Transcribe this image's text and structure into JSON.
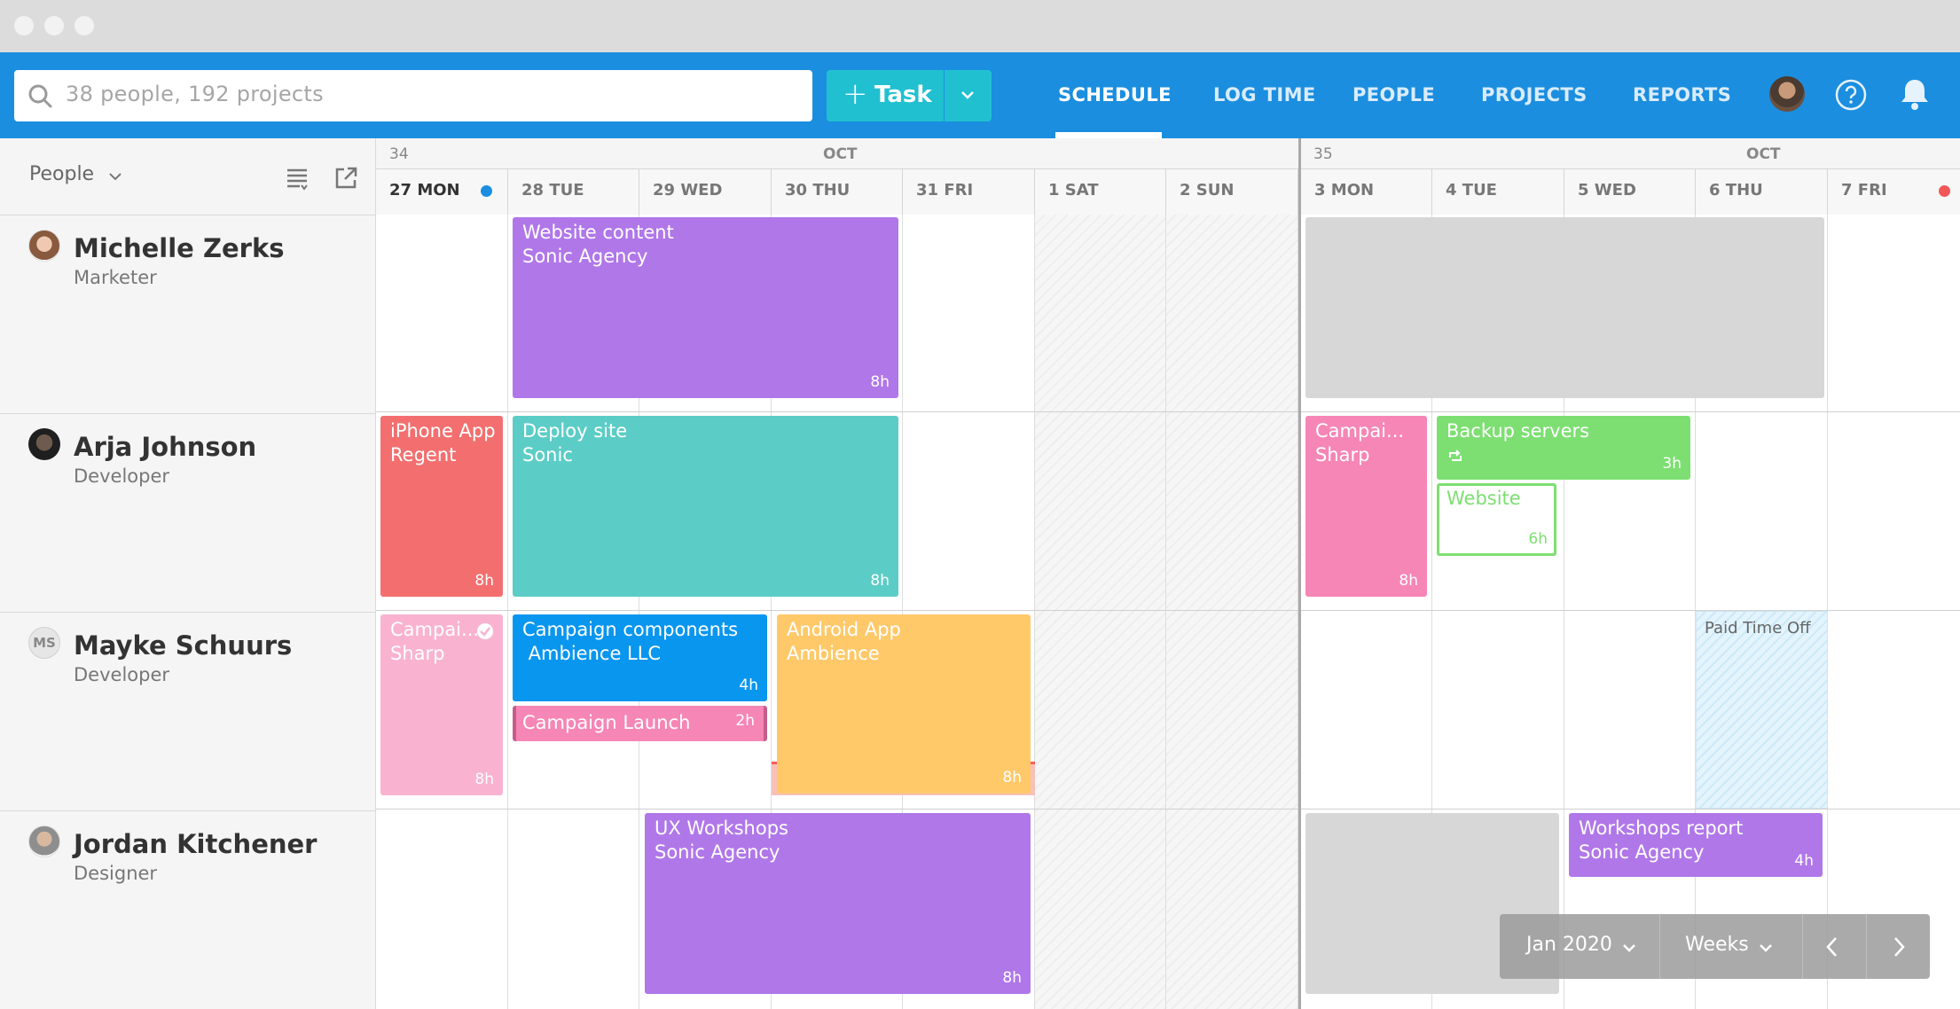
{
  "search": {
    "placeholder": "38 people, 192 projects"
  },
  "toolbar": {
    "task_label": "Task",
    "plus": "+"
  },
  "nav": {
    "schedule": "SCHEDULE",
    "log_time": "LOG TIME",
    "people": "PEOPLE",
    "projects": "PROJECTS",
    "reports": "REPORTS"
  },
  "sidebar": {
    "people_filter": "People"
  },
  "calendar": {
    "weeks": [
      {
        "number": "34",
        "month": "OCT"
      },
      {
        "number": "35",
        "month": "OCT"
      }
    ],
    "days": [
      "27 MON",
      "28 TUE",
      "29 WED",
      "30 THU",
      "31 FRI",
      "1 SAT",
      "2 SUN",
      "3 MON",
      "4 TUE",
      "5 WED",
      "6 THU",
      "7 FRI"
    ]
  },
  "people": [
    {
      "name": "Michelle Zerks",
      "role": "Marketer"
    },
    {
      "name": "Arja Johnson",
      "role": "Developer"
    },
    {
      "name": "Mayke Schuurs",
      "role": "Developer",
      "initials": "MS"
    },
    {
      "name": "Jordan Kitchener",
      "role": "Designer"
    }
  ],
  "tasks": {
    "website_content": {
      "line1": "Website content",
      "line2": "Sonic Agency",
      "hours": "8h",
      "color": "#b077e9"
    },
    "iphone_app": {
      "line1": "iPhone App",
      "line2": "Regent",
      "hours": "8h",
      "color": "#f36f6f"
    },
    "deploy_site": {
      "line1": "Deploy site",
      "line2": "Sonic",
      "hours": "8h",
      "color": "#5ccdc6"
    },
    "campaign_sharp_arja": {
      "line1": "Campai...",
      "line2": "Sharp",
      "hours": "8h",
      "color": "#f686b6"
    },
    "backup_servers": {
      "line1": "Backup servers",
      "hours": "3h",
      "color": "#7ddf72"
    },
    "website": {
      "line1": "Website",
      "hours": "6h",
      "color": "#7ddf72"
    },
    "campaign_sharp_mayke": {
      "line1": "Campai...",
      "line2": "Sharp",
      "hours": "8h",
      "color": "#f9b3d1"
    },
    "campaign_components": {
      "line1": "Campaign components",
      "line2": " Ambience LLC",
      "hours": "4h",
      "color": "#0996ef"
    },
    "campaign_launch": {
      "line1": "Campaign Launch",
      "hours": "2h",
      "color": "#f686b6"
    },
    "android_app": {
      "line1": "Android App",
      "line2": "Ambience",
      "hours": "8h",
      "color": "#ffc96a"
    },
    "paid_time_off": {
      "label": "Paid Time Off"
    },
    "ux_workshops": {
      "line1": "UX Workshops",
      "line2": "Sonic Agency",
      "hours": "8h",
      "color": "#b077e9"
    },
    "workshops_report": {
      "line1": "Workshops report",
      "line2": "Sonic Agency",
      "hours": "4h",
      "color": "#b077e9"
    }
  },
  "controls": {
    "month": "Jan 2020",
    "view": "Weeks"
  },
  "colors": {
    "brand": "#1b8edf",
    "accent": "#20c0d1",
    "today_dot": "#1b8edf",
    "alert_dot": "#f25757"
  }
}
